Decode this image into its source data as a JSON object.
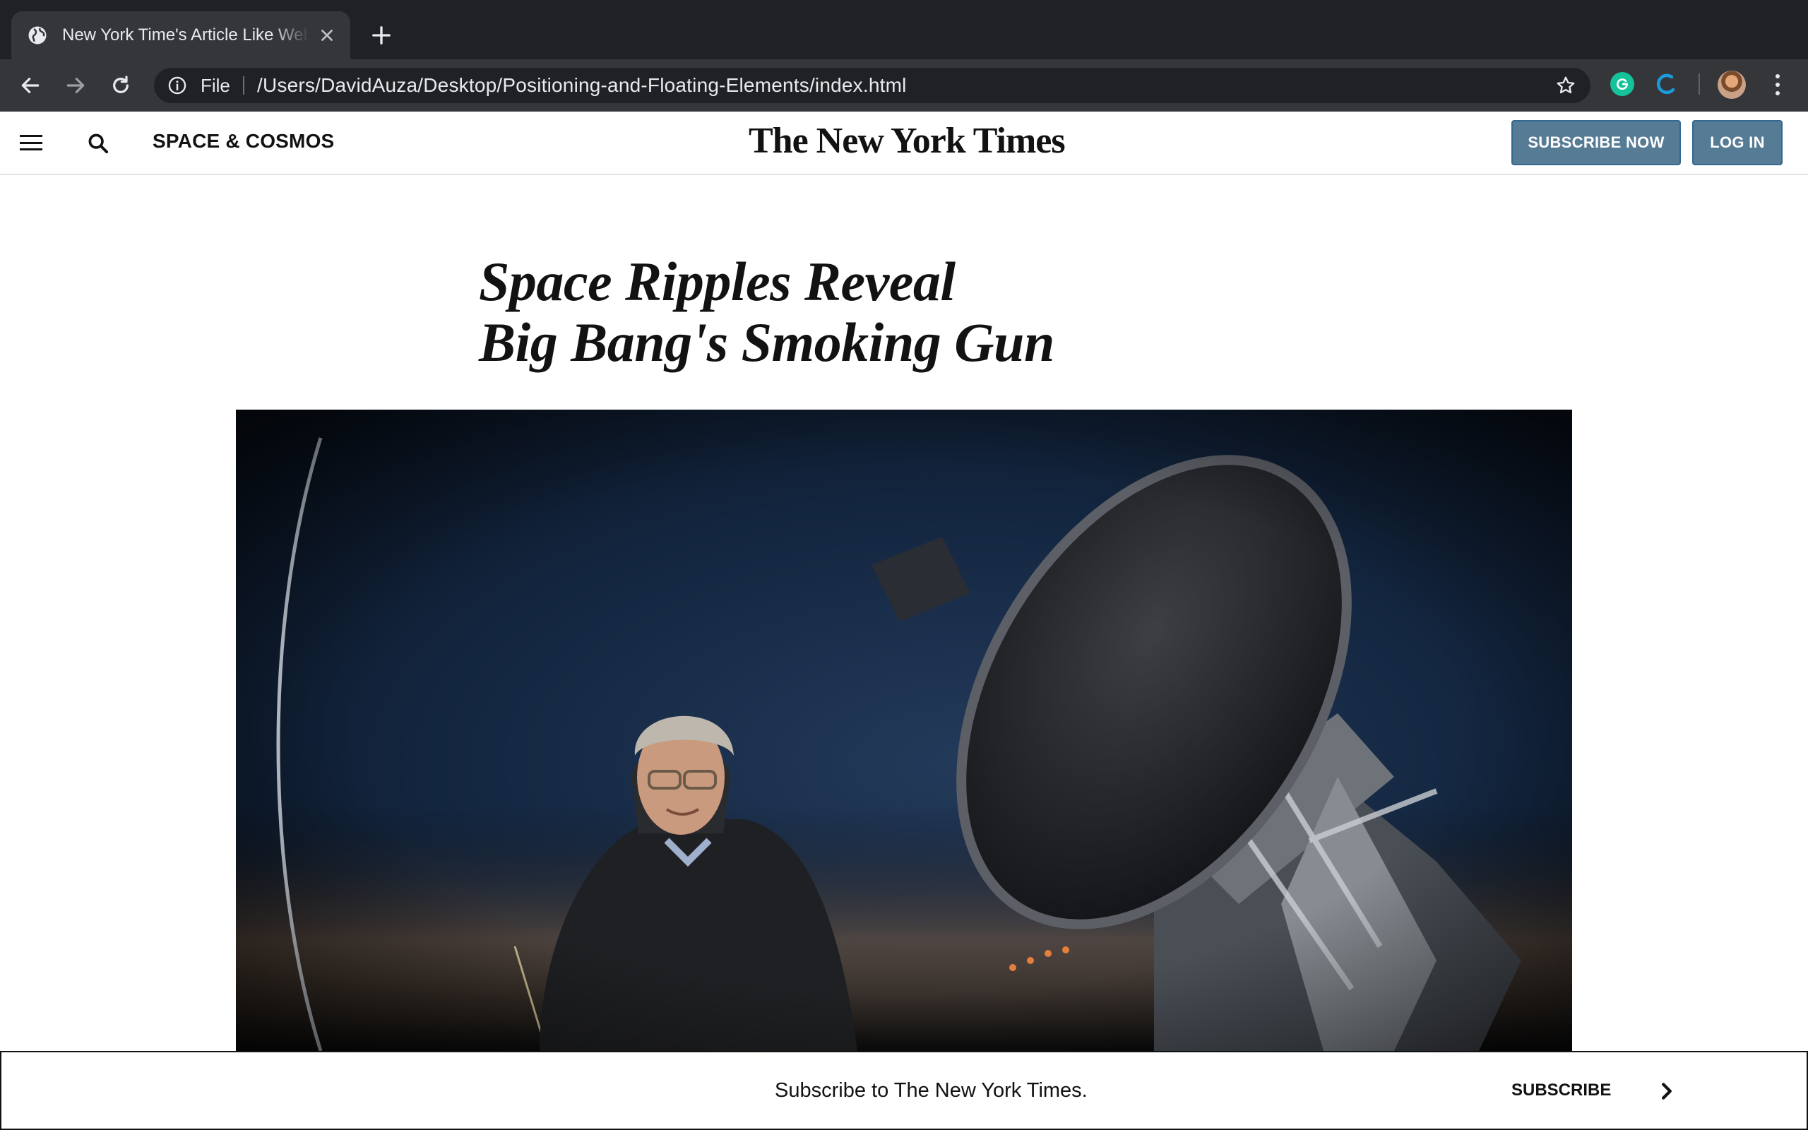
{
  "browser": {
    "tab_title": "New York Time's Article Like Web Page",
    "url_scheme": "File",
    "url": "/Users/DavidAuza/Desktop/Positioning-and-Floating-Elements/index.html",
    "icons": [
      "globe-icon",
      "close-icon",
      "plus-icon",
      "back-arrow-icon",
      "forward-arrow-icon",
      "reload-icon",
      "info-icon",
      "star-icon",
      "grammarly-icon",
      "extension-icon",
      "avatar",
      "more-vert-icon"
    ]
  },
  "header": {
    "section": "SPACE & COSMOS",
    "masthead": "The New York Times",
    "subscribe_label": "SUBSCRIBE NOW",
    "login_label": "LOG IN",
    "button_color": "#567b95"
  },
  "article": {
    "headline_line1": "Space Ripples Reveal",
    "headline_line2": "Big Bang's Smoking Gun",
    "photo": "man-beside-telescope-at-dusk"
  },
  "subscribe_bar": {
    "text": "Subscribe to The New York Times.",
    "link_label": "SUBSCRIBE"
  },
  "colors": {
    "chrome_dark": "#202124",
    "chrome_toolbar": "#35363a",
    "grammarly_green": "#15c39a",
    "ext_blue": "#1a9bdb"
  }
}
